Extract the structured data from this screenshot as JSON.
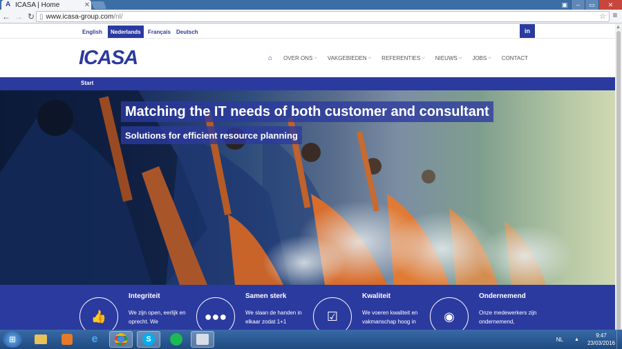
{
  "browser": {
    "tab_title": "ICASA | Home",
    "tab_favicon": "icasa-a-icon",
    "url_host": "www.icasa-group.com",
    "url_path": "/nl/"
  },
  "site": {
    "languages": [
      "English",
      "Nederlands",
      "Français",
      "Deutsch"
    ],
    "active_language": "Nederlands",
    "social": "in",
    "logo": "ICASA",
    "nav": [
      "OVER ONS",
      "VAKGEBIEDEN",
      "REFERENTIES",
      "NIEUWS",
      "JOBS",
      "CONTACT"
    ],
    "breadcrumb": "Start",
    "hero_headline": "Matching the IT needs of both customer and consultant",
    "hero_subheadline": "Solutions for efficient resource planning",
    "values": [
      {
        "title": "Integriteit",
        "text": "We zijn open, eerlijk en oprecht. We",
        "icon": "thumbs-up-icon"
      },
      {
        "title": "Samen sterk",
        "text": "We slaan de handen in elkaar zodat 1+1",
        "icon": "team-icon"
      },
      {
        "title": "Kwaliteit",
        "text": "We voeren kwaliteit en vakmanschap hoog in",
        "icon": "checkbox-icon"
      },
      {
        "title": "Ondernemend",
        "text": "Onze medewerkers zijn ondernemend,",
        "icon": "globe-icon"
      }
    ],
    "brand_color": "#2b3a9f"
  },
  "taskbar": {
    "language": "NL",
    "time": "9:47",
    "date": "23/03/2016",
    "apps": [
      "file-explorer-icon",
      "media-player-icon",
      "internet-explorer-icon",
      "chrome-icon",
      "skype-icon",
      "spotify-icon",
      "network-app-icon"
    ]
  }
}
